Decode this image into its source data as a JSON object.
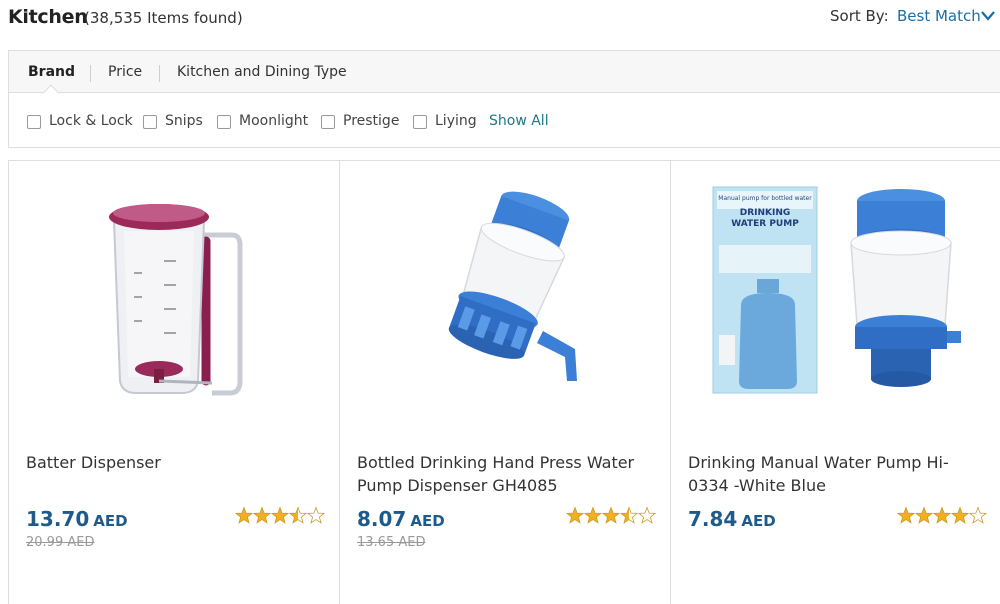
{
  "header": {
    "title": "Kitchen",
    "count": "(38,535 Items found)",
    "sort_label": "Sort By:",
    "sort_value": "Best Match"
  },
  "filters": {
    "tabs": [
      "Brand",
      "Price",
      "Kitchen and Dining Type"
    ],
    "active_tab": "Brand",
    "brands": [
      "Lock & Lock",
      "Snips",
      "Moonlight",
      "Prestige",
      "Liying"
    ],
    "show_all": "Show All"
  },
  "products": [
    {
      "name": "Batter Dispenser",
      "price": "13.70",
      "currency": "AED",
      "old_price": "20.99 AED",
      "rating": 3.5,
      "image_icon": "batter-dispenser-image"
    },
    {
      "name": "Bottled Drinking Hand Press Water Pump Dispenser GH4085",
      "price": "8.07",
      "currency": "AED",
      "old_price": "13.65 AED",
      "rating": 3.5,
      "image_icon": "water-pump-image"
    },
    {
      "name": "Drinking Manual Water Pump Hi-0334 -White Blue",
      "price": "7.84",
      "currency": "AED",
      "old_price": "",
      "rating": 4,
      "image_icon": "water-pump-box-image",
      "box_text": [
        "Manual pump for bottled water",
        "DRINKING",
        "WATER PUMP"
      ]
    }
  ],
  "colors": {
    "link": "#1a6fa8",
    "price": "#1e5a8a",
    "star": "#f2b01e"
  }
}
